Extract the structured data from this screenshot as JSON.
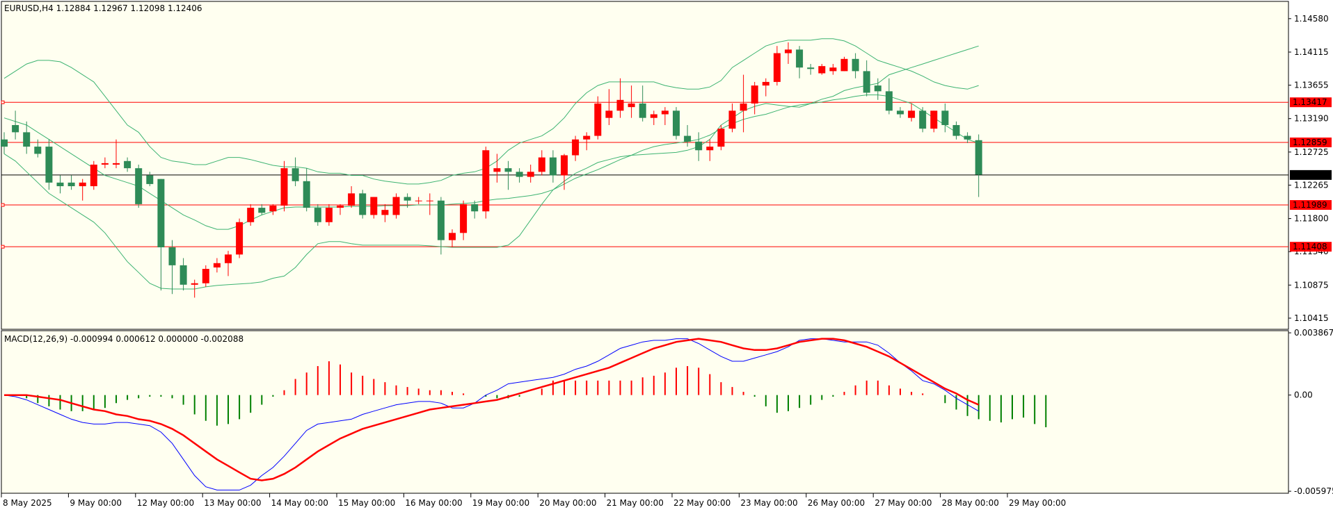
{
  "chart_data": [
    {
      "type": "candlestick",
      "title": "EURUSD,H4  1.12884 1.12967 1.12098 1.12406",
      "y_ticks": [
        "1.14580",
        "1.14115",
        "1.13655",
        "1.13190",
        "1.12725",
        "1.12265",
        "1.11800",
        "1.11340",
        "1.10875",
        "1.10415"
      ],
      "ylim": [
        1.1026,
        1.1482
      ],
      "x_labels": [
        "8 May 2025",
        "9 May 00:00",
        "12 May 00:00",
        "13 May 00:00",
        "14 May 00:00",
        "15 May 00:00",
        "16 May 00:00",
        "19 May 00:00",
        "20 May 00:00",
        "21 May 00:00",
        "22 May 00:00",
        "23 May 00:00",
        "26 May 00:00",
        "27 May 00:00",
        "28 May 00:00",
        "29 May 00:00"
      ],
      "price_lines": [
        {
          "label": "1.13417",
          "value": 1.13417,
          "color": "#ff0000"
        },
        {
          "label": "1.12859",
          "value": 1.12859,
          "color": "#ff0000"
        },
        {
          "label": "1.11989",
          "value": 1.11989,
          "color": "#ff0000"
        },
        {
          "label": "1.11408",
          "value": 1.11408,
          "color": "#ff0000"
        }
      ],
      "current_price": {
        "label": "1.12406",
        "value": 1.12406
      },
      "candles": [
        [
          1.129,
          1.13,
          1.127,
          1.128
        ],
        [
          1.131,
          1.133,
          1.129,
          1.13
        ],
        [
          1.13,
          1.1315,
          1.127,
          1.128
        ],
        [
          1.128,
          1.129,
          1.1265,
          1.127
        ],
        [
          1.128,
          1.129,
          1.122,
          1.123
        ],
        [
          1.123,
          1.124,
          1.1215,
          1.1225
        ],
        [
          1.123,
          1.124,
          1.122,
          1.1225
        ],
        [
          1.1225,
          1.1235,
          1.1205,
          1.123
        ],
        [
          1.1225,
          1.126,
          1.122,
          1.1255
        ],
        [
          1.1255,
          1.1265,
          1.125,
          1.1257
        ],
        [
          1.1255,
          1.129,
          1.125,
          1.1257
        ],
        [
          1.126,
          1.1265,
          1.1245,
          1.125
        ],
        [
          1.125,
          1.1255,
          1.1195,
          1.12
        ],
        [
          1.124,
          1.1245,
          1.1225,
          1.1228
        ],
        [
          1.1235,
          1.1235,
          1.108,
          1.114
        ],
        [
          1.114,
          1.115,
          1.1075,
          1.1115
        ],
        [
          1.1115,
          1.1125,
          1.108,
          1.1088
        ],
        [
          1.1088,
          1.1095,
          1.107,
          1.109
        ],
        [
          1.109,
          1.1115,
          1.1085,
          1.111
        ],
        [
          1.1112,
          1.1125,
          1.1105,
          1.1118
        ],
        [
          1.1118,
          1.1135,
          1.11,
          1.113
        ],
        [
          1.113,
          1.118,
          1.1125,
          1.1175
        ],
        [
          1.1175,
          1.12,
          1.117,
          1.1195
        ],
        [
          1.1195,
          1.12,
          1.1185,
          1.1188
        ],
        [
          1.119,
          1.12,
          1.1185,
          1.1198
        ],
        [
          1.1198,
          1.126,
          1.119,
          1.125
        ],
        [
          1.125,
          1.1265,
          1.1225,
          1.1232
        ],
        [
          1.1232,
          1.125,
          1.119,
          1.1195
        ],
        [
          1.1195,
          1.12,
          1.117,
          1.1175
        ],
        [
          1.1175,
          1.12,
          1.117,
          1.1195
        ],
        [
          1.1195,
          1.12,
          1.1185,
          1.1198
        ],
        [
          1.1198,
          1.1225,
          1.1195,
          1.1215
        ],
        [
          1.1215,
          1.122,
          1.118,
          1.1185
        ],
        [
          1.1185,
          1.121,
          1.118,
          1.121
        ],
        [
          1.1185,
          1.12,
          1.1175,
          1.1192
        ],
        [
          1.1185,
          1.1215,
          1.118,
          1.121
        ],
        [
          1.121,
          1.1215,
          1.1195,
          1.1205
        ],
        [
          1.1205,
          1.121,
          1.12,
          1.1205
        ],
        [
          1.1205,
          1.1215,
          1.1185,
          1.1205
        ],
        [
          1.1205,
          1.121,
          1.113,
          1.115
        ],
        [
          1.115,
          1.1165,
          1.114,
          1.116
        ],
        [
          1.116,
          1.1205,
          1.115,
          1.12
        ],
        [
          1.12,
          1.1205,
          1.118,
          1.119
        ],
        [
          1.119,
          1.128,
          1.118,
          1.1275
        ],
        [
          1.1245,
          1.127,
          1.123,
          1.125
        ],
        [
          1.125,
          1.126,
          1.122,
          1.1245
        ],
        [
          1.1245,
          1.125,
          1.123,
          1.1238
        ],
        [
          1.1238,
          1.1255,
          1.123,
          1.1245
        ],
        [
          1.1245,
          1.1275,
          1.124,
          1.1265
        ],
        [
          1.1265,
          1.1275,
          1.123,
          1.124
        ],
        [
          1.124,
          1.127,
          1.122,
          1.1268
        ],
        [
          1.1268,
          1.1295,
          1.126,
          1.129
        ],
        [
          1.129,
          1.13,
          1.1275,
          1.1295
        ],
        [
          1.1295,
          1.135,
          1.129,
          1.134
        ],
        [
          1.132,
          1.136,
          1.131,
          1.133
        ],
        [
          1.133,
          1.1375,
          1.132,
          1.1345
        ],
        [
          1.1335,
          1.1365,
          1.132,
          1.134
        ],
        [
          1.134,
          1.1365,
          1.1315,
          1.132
        ],
        [
          1.132,
          1.133,
          1.131,
          1.1325
        ],
        [
          1.1325,
          1.1335,
          1.131,
          1.133
        ],
        [
          1.133,
          1.1335,
          1.129,
          1.1295
        ],
        [
          1.1295,
          1.131,
          1.128,
          1.1287
        ],
        [
          1.1287,
          1.13,
          1.126,
          1.1275
        ],
        [
          1.1275,
          1.129,
          1.126,
          1.128
        ],
        [
          1.128,
          1.131,
          1.1275,
          1.1305
        ],
        [
          1.1305,
          1.134,
          1.13,
          1.133
        ],
        [
          1.133,
          1.138,
          1.13,
          1.134
        ],
        [
          1.134,
          1.137,
          1.1325,
          1.1365
        ],
        [
          1.1365,
          1.1375,
          1.135,
          1.137
        ],
        [
          1.137,
          1.142,
          1.1365,
          1.141
        ],
        [
          1.141,
          1.1425,
          1.1395,
          1.1415
        ],
        [
          1.1415,
          1.142,
          1.1375,
          1.139
        ],
        [
          1.139,
          1.1395,
          1.138,
          1.1388
        ],
        [
          1.1382,
          1.1395,
          1.138,
          1.1392
        ],
        [
          1.1385,
          1.1395,
          1.138,
          1.139
        ],
        [
          1.1385,
          1.1405,
          1.1385,
          1.1402
        ],
        [
          1.1402,
          1.141,
          1.1375,
          1.1385
        ],
        [
          1.1385,
          1.14,
          1.135,
          1.1355
        ],
        [
          1.1365,
          1.1375,
          1.1345,
          1.1357
        ],
        [
          1.1357,
          1.1375,
          1.1325,
          1.133
        ],
        [
          1.133,
          1.1335,
          1.132,
          1.1325
        ],
        [
          1.132,
          1.134,
          1.1315,
          1.133
        ],
        [
          1.133,
          1.1335,
          1.13,
          1.1305
        ],
        [
          1.1305,
          1.133,
          1.13,
          1.133
        ],
        [
          1.133,
          1.134,
          1.13,
          1.131
        ],
        [
          1.131,
          1.1315,
          1.129,
          1.1295
        ],
        [
          1.1295,
          1.13,
          1.1285,
          1.129
        ],
        [
          1.1289,
          1.1297,
          1.121,
          1.1241
        ]
      ],
      "bands": {
        "color": "#3cb371",
        "upper": [
          1.1375,
          1.1385,
          1.1395,
          1.14,
          1.14,
          1.1398,
          1.139,
          1.138,
          1.137,
          1.135,
          1.133,
          1.131,
          1.13,
          1.128,
          1.1265,
          1.126,
          1.1258,
          1.1255,
          1.1255,
          1.126,
          1.1265,
          1.1265,
          1.1262,
          1.1258,
          1.1254,
          1.1252,
          1.1252,
          1.125,
          1.1245,
          1.1243,
          1.1243,
          1.124,
          1.124,
          1.1235,
          1.1232,
          1.123,
          1.1228,
          1.1228,
          1.123,
          1.1233,
          1.124,
          1.1243,
          1.1245,
          1.125,
          1.126,
          1.1275,
          1.1285,
          1.129,
          1.1295,
          1.1305,
          1.132,
          1.134,
          1.1355,
          1.1365,
          1.137,
          1.137,
          1.137,
          1.137,
          1.137,
          1.1365,
          1.1362,
          1.136,
          1.136,
          1.1363,
          1.1372,
          1.139,
          1.14,
          1.141,
          1.142,
          1.1425,
          1.1428,
          1.1428,
          1.1428,
          1.143,
          1.143,
          1.1427,
          1.142,
          1.141,
          1.14,
          1.1395,
          1.139,
          1.1385,
          1.1378,
          1.137,
          1.1365,
          1.1362,
          1.136,
          1.1365
        ],
        "middle": [
          1.132,
          1.1315,
          1.131,
          1.13,
          1.129,
          1.128,
          1.127,
          1.126,
          1.125,
          1.124,
          1.1235,
          1.123,
          1.1225,
          1.1215,
          1.1205,
          1.1195,
          1.1185,
          1.1178,
          1.117,
          1.1165,
          1.1165,
          1.117,
          1.1178,
          1.1185,
          1.119,
          1.1195,
          1.1196,
          1.1196,
          1.1196,
          1.1196,
          1.1196,
          1.1197,
          1.1197,
          1.1197,
          1.1198,
          1.1198,
          1.1198,
          1.1199,
          1.1199,
          1.1199,
          1.12,
          1.1201,
          1.1202,
          1.1205,
          1.1207,
          1.1208,
          1.121,
          1.1212,
          1.1215,
          1.122,
          1.1228,
          1.1236,
          1.1242,
          1.1248,
          1.1255,
          1.1262,
          1.1268,
          1.1275,
          1.128,
          1.1283,
          1.1285,
          1.1287,
          1.129,
          1.1296,
          1.1305,
          1.1312,
          1.1318,
          1.1322,
          1.1325,
          1.133,
          1.1335,
          1.1338,
          1.134,
          1.1342,
          1.1345,
          1.1347,
          1.135,
          1.1352,
          1.1352,
          1.135,
          1.1345,
          1.134,
          1.133,
          1.132,
          1.131,
          1.13,
          1.129,
          1.1285
        ],
        "lower": [
          1.127,
          1.126,
          1.1245,
          1.123,
          1.1215,
          1.1205,
          1.1195,
          1.1185,
          1.1175,
          1.116,
          1.114,
          1.112,
          1.1105,
          1.109,
          1.1083,
          1.1082,
          1.1082,
          1.1082,
          1.1085,
          1.1087,
          1.1088,
          1.1089,
          1.109,
          1.1092,
          1.1097,
          1.11,
          1.1112,
          1.113,
          1.1145,
          1.1148,
          1.1148,
          1.1145,
          1.1143,
          1.1143,
          1.1143,
          1.1143,
          1.1143,
          1.1143,
          1.1142,
          1.1141,
          1.114,
          1.114,
          1.114,
          1.114,
          1.114,
          1.1143,
          1.1156,
          1.1178,
          1.12,
          1.122,
          1.1232,
          1.1243,
          1.125,
          1.1258,
          1.1262,
          1.1266,
          1.1268,
          1.1269,
          1.127,
          1.1271,
          1.1272,
          1.1275,
          1.128,
          1.129,
          1.131,
          1.132,
          1.133,
          1.1336,
          1.134,
          1.1338,
          1.1336,
          1.1335,
          1.134,
          1.1346,
          1.135,
          1.1358,
          1.1362,
          1.1365,
          1.1368,
          1.138,
          1.1385,
          1.139,
          1.1395,
          1.14,
          1.1405,
          1.141,
          1.1415,
          1.142
        ]
      }
    },
    {
      "type": "bar+line",
      "title": "MACD(12,26,9) -0.000994 0.000612 0.000000 -0.002088",
      "y_ticks": [
        "0.003867",
        "0.00",
        "-0.005975"
      ],
      "ylim": [
        -0.0061,
        0.004
      ],
      "series": [
        {
          "color": "#0000ff",
          "values": [
            0.0,
            -0.0001,
            -0.0003,
            -0.0006,
            -0.0009,
            -0.0012,
            -0.0015,
            -0.0017,
            -0.0018,
            -0.0018,
            -0.0017,
            -0.0017,
            -0.0018,
            -0.0019,
            -0.0023,
            -0.003,
            -0.004,
            -0.005,
            -0.0057,
            -0.0059,
            -0.0059,
            -0.0059,
            -0.0056,
            -0.005,
            -0.0045,
            -0.0038,
            -0.003,
            -0.0022,
            -0.0018,
            -0.0017,
            -0.0016,
            -0.0015,
            -0.0012,
            -0.001,
            -0.0008,
            -0.0006,
            -0.0005,
            -0.0004,
            -0.0004,
            -0.0005,
            -0.0008,
            -0.0008,
            -0.0005,
            0.0,
            0.0003,
            0.0007,
            0.0008,
            0.0009,
            0.001,
            0.0011,
            0.0013,
            0.0016,
            0.0018,
            0.0021,
            0.0025,
            0.0029,
            0.0031,
            0.0033,
            0.0034,
            0.0034,
            0.0035,
            0.0035,
            0.0032,
            0.0028,
            0.0024,
            0.0021,
            0.0021,
            0.0023,
            0.0025,
            0.0027,
            0.003,
            0.0034,
            0.0035,
            0.0035,
            0.0034,
            0.0033,
            0.0033,
            0.0033,
            0.0031,
            0.0026,
            0.002,
            0.0015,
            0.0009,
            0.0007,
            0.0003,
            -0.0002,
            -0.0006,
            -0.001
          ]
        },
        {
          "color": "#ff0000",
          "values": [
            0.0,
            0.0,
            0.0,
            -0.0001,
            -0.0002,
            -0.0003,
            -0.0005,
            -0.0007,
            -0.0009,
            -0.001,
            -0.0012,
            -0.0013,
            -0.0015,
            -0.0016,
            -0.0018,
            -0.0021,
            -0.0025,
            -0.003,
            -0.0035,
            -0.004,
            -0.0044,
            -0.0048,
            -0.0052,
            -0.0053,
            -0.0052,
            -0.0049,
            -0.0045,
            -0.004,
            -0.0035,
            -0.0031,
            -0.0027,
            -0.0024,
            -0.0021,
            -0.0019,
            -0.0017,
            -0.0015,
            -0.0013,
            -0.0011,
            -0.0009,
            -0.0008,
            -0.0007,
            -0.0006,
            -0.0005,
            -0.0004,
            -0.0003,
            -0.0001,
            0.0001,
            0.0003,
            0.0005,
            0.0007,
            0.0009,
            0.0011,
            0.0013,
            0.0015,
            0.0017,
            0.002,
            0.0023,
            0.0026,
            0.0029,
            0.0031,
            0.0033,
            0.0034,
            0.0035,
            0.0034,
            0.0033,
            0.0031,
            0.0029,
            0.0028,
            0.0028,
            0.0029,
            0.0031,
            0.0033,
            0.0034,
            0.0035,
            0.0035,
            0.0034,
            0.0032,
            0.003,
            0.0027,
            0.0024,
            0.002,
            0.0016,
            0.0012,
            0.0008,
            0.0004,
            0.0001,
            -0.0003,
            -0.0006
          ]
        }
      ],
      "histogram": {
        "color_up": "#ff0000",
        "color_down": "#008000",
        "values": [
          0.0,
          0.0,
          -0.0002,
          -0.0005,
          -0.0007,
          -0.0009,
          -0.001,
          -0.001,
          -0.0009,
          -0.0008,
          -0.0005,
          -0.0003,
          -0.0002,
          -0.0001,
          -0.0001,
          -0.0002,
          -0.0006,
          -0.0012,
          -0.0016,
          -0.0019,
          -0.0018,
          -0.0015,
          -0.0011,
          -0.0006,
          -0.0001,
          0.0003,
          0.001,
          0.0014,
          0.0018,
          0.0021,
          0.0019,
          0.0014,
          0.0012,
          0.001,
          0.0008,
          0.0006,
          0.0005,
          0.0004,
          0.0003,
          0.0003,
          0.0002,
          0.0001,
          0.0,
          -0.0001,
          -0.0002,
          -0.0002,
          -0.0001,
          0.0,
          0.0004,
          0.0009,
          0.0009,
          0.0009,
          0.0009,
          0.0009,
          0.0009,
          0.0009,
          0.0009,
          0.0011,
          0.0012,
          0.0014,
          0.0017,
          0.0018,
          0.0017,
          0.0013,
          0.0008,
          0.0005,
          0.0002,
          -0.0001,
          -0.0007,
          -0.0011,
          -0.001,
          -0.0008,
          -0.0006,
          -0.0003,
          -0.0001,
          0.0002,
          0.0006,
          0.0009,
          0.0009,
          0.0006,
          0.0004,
          0.0002,
          0.0001,
          0.0,
          -0.0005,
          -0.0009,
          -0.0013,
          -0.0015,
          -0.0016,
          -0.0017,
          -0.0015,
          -0.0014,
          -0.0018,
          -0.002
        ]
      }
    }
  ]
}
